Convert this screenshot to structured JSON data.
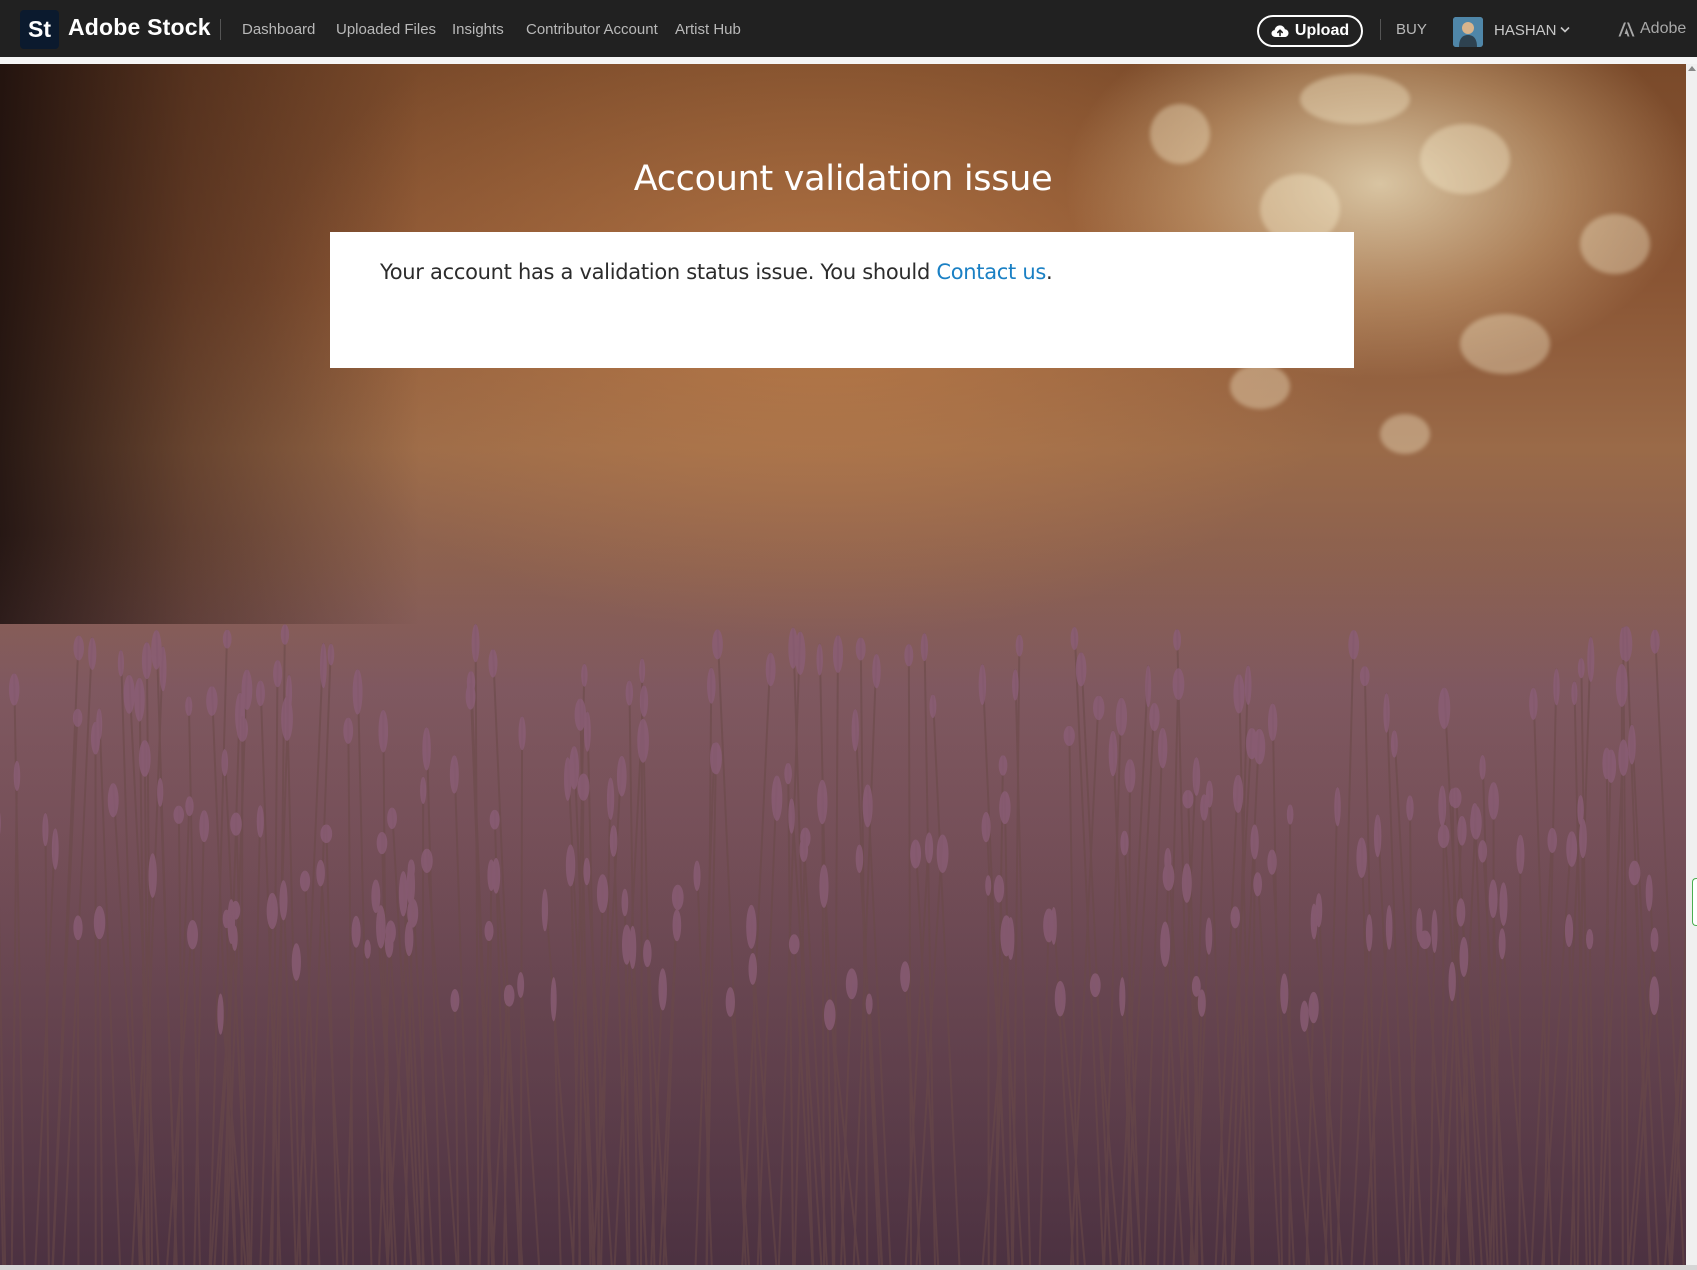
{
  "brand": {
    "badge": "St",
    "name": "Adobe Stock"
  },
  "nav": {
    "items": [
      {
        "label": "Dashboard"
      },
      {
        "label": "Uploaded Files"
      },
      {
        "label": "Insights"
      },
      {
        "label": "Contributor Account"
      },
      {
        "label": "Artist Hub"
      }
    ]
  },
  "header_actions": {
    "upload_label": "Upload",
    "upload_icon": "cloud-upload-icon",
    "buy_label": "BUY",
    "user_name": "HASHAN",
    "adobe_label": "Adobe"
  },
  "main": {
    "title": "Account validation issue",
    "message_prefix": "Your account has a validation status issue. You should ",
    "contact_link": "Contact us",
    "message_suffix": "."
  },
  "colors": {
    "topbar": "#212121",
    "link": "#1a80c4",
    "notice_bg": "#ffffff"
  }
}
